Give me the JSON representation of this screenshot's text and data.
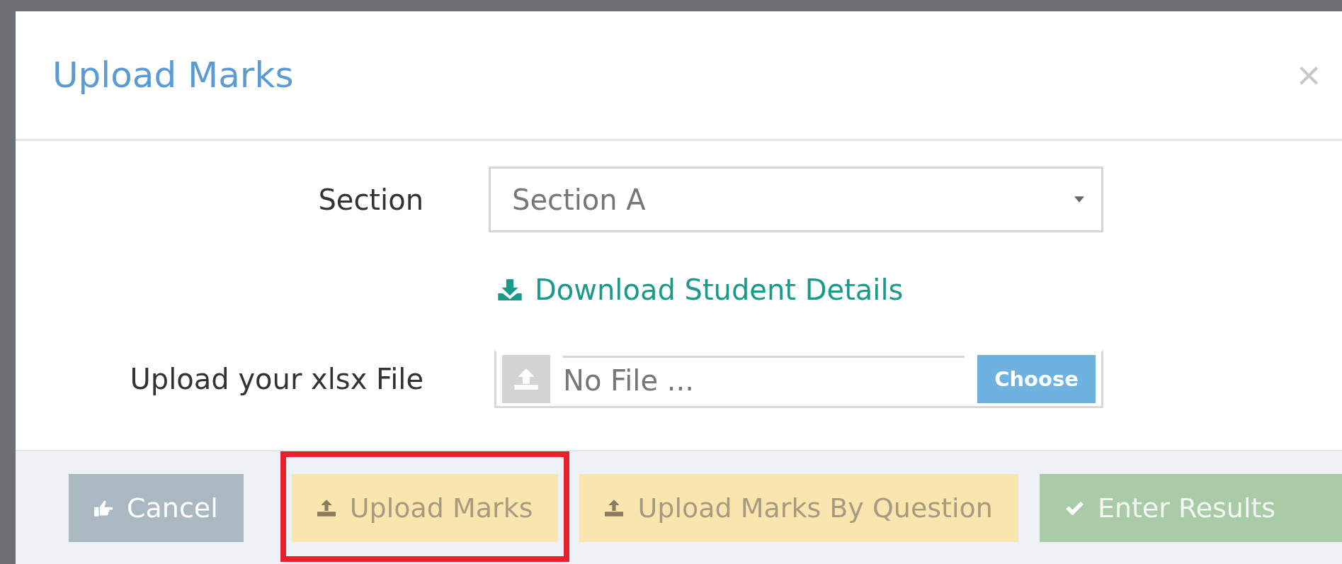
{
  "dialog": {
    "title": "Upload Marks",
    "close": "×"
  },
  "form": {
    "section_label": "Section",
    "section_value": "Section A",
    "download_link": "Download Student Details",
    "file_label": "Upload your xlsx File",
    "file_placeholder": "No File ...",
    "choose_button": "Choose"
  },
  "buttons": [
    {
      "label": "Cancel",
      "kind": "cancel",
      "disabled": false,
      "highlighted": false
    },
    {
      "label": "Upload Marks",
      "kind": "upload",
      "disabled": true,
      "highlighted": true
    },
    {
      "label": "Upload Marks By Question",
      "kind": "upload",
      "disabled": true,
      "highlighted": false
    },
    {
      "label": "Enter Results",
      "kind": "confirm",
      "disabled": true,
      "highlighted": false
    }
  ]
}
